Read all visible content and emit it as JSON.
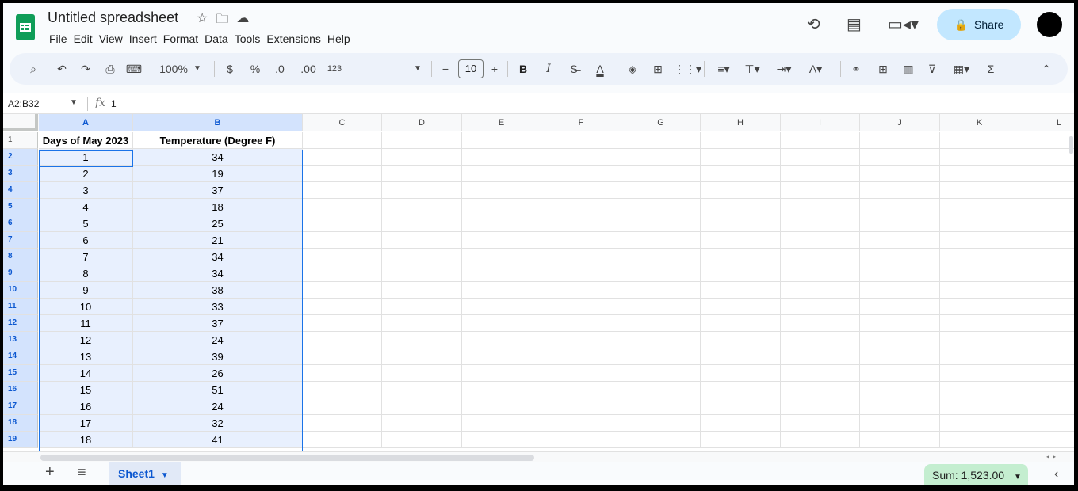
{
  "app": {
    "doc_title": "Untitled spreadsheet",
    "menu": [
      "File",
      "Edit",
      "View",
      "Insert",
      "Format",
      "Data",
      "Tools",
      "Extensions",
      "Help"
    ],
    "share_label": "Share"
  },
  "toolbar": {
    "zoom": "100%",
    "currency": "$",
    "percent": "%",
    "decrease_decimal": ".0",
    "increase_decimal": ".00",
    "number_format": "123",
    "font_size": "10",
    "bold": "B",
    "italic": "I",
    "text_color": "A",
    "sum_symbol": "Σ"
  },
  "formula_bar": {
    "name_box": "A2:B32",
    "fx": "fx",
    "value": "1"
  },
  "grid": {
    "columns": [
      "A",
      "B",
      "C",
      "D",
      "E",
      "F",
      "G",
      "H",
      "I",
      "J",
      "K",
      "L"
    ],
    "header_row": [
      "Days of May 2023",
      "Temperature (Degree F)"
    ],
    "rows": [
      [
        "1",
        "34"
      ],
      [
        "2",
        "19"
      ],
      [
        "3",
        "37"
      ],
      [
        "4",
        "18"
      ],
      [
        "5",
        "25"
      ],
      [
        "6",
        "21"
      ],
      [
        "7",
        "34"
      ],
      [
        "8",
        "34"
      ],
      [
        "9",
        "38"
      ],
      [
        "10",
        "33"
      ],
      [
        "11",
        "37"
      ],
      [
        "12",
        "24"
      ],
      [
        "13",
        "39"
      ],
      [
        "14",
        "26"
      ],
      [
        "15",
        "51"
      ],
      [
        "16",
        "24"
      ],
      [
        "17",
        "32"
      ],
      [
        "18",
        "41"
      ]
    ],
    "row_numbers": [
      "1",
      "2",
      "3",
      "4",
      "5",
      "6",
      "7",
      "8",
      "9",
      "10",
      "11",
      "12",
      "13",
      "14",
      "15",
      "16",
      "17",
      "18",
      "19"
    ]
  },
  "bottom": {
    "sheet_name": "Sheet1",
    "sum_label": "Sum: 1,523.00"
  },
  "colors": {
    "accent": "#1a73e8",
    "share_bg": "#c2e7ff",
    "sum_bg": "#c4eed0",
    "logo_green": "#0f9d58"
  }
}
